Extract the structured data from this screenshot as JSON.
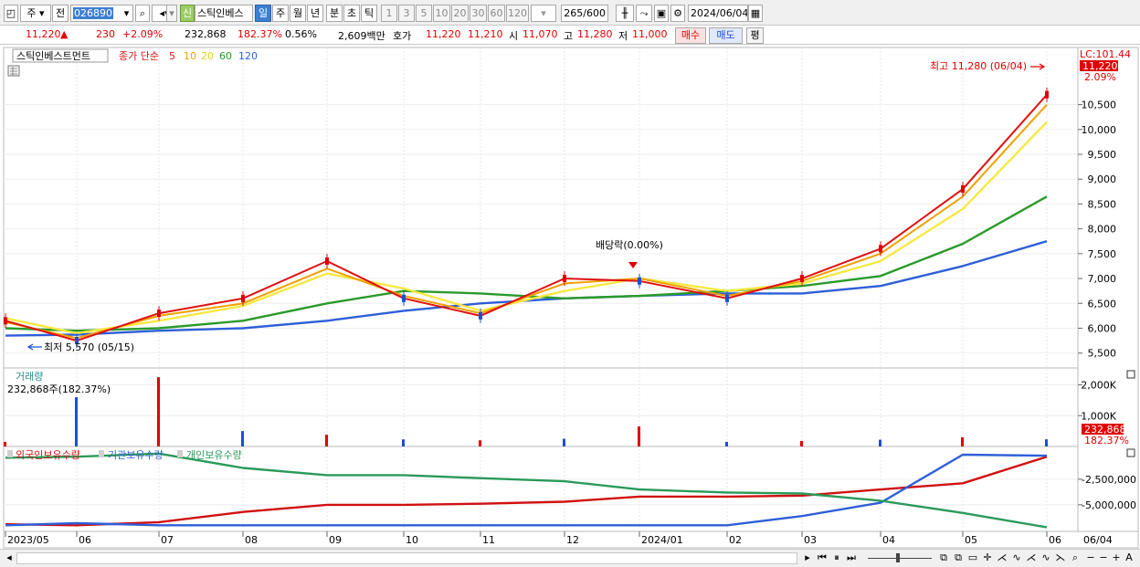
{
  "toolbar": {
    "market": "주",
    "prev": "전",
    "code": "026890",
    "shin": "신",
    "stock_name": "스틱인베스",
    "periods": [
      "일",
      "주",
      "월",
      "년",
      "분",
      "초",
      "틱"
    ],
    "active_period": "일",
    "minutes": [
      "1",
      "3",
      "5",
      "10",
      "20",
      "30",
      "60",
      "120"
    ],
    "count": "265",
    "count_max": "/600",
    "date": "2024/06/04"
  },
  "quote": {
    "price": "11,220",
    "arrow": "▲",
    "change": "230",
    "change_pct": "+2.09%",
    "volume": "232,868",
    "volume_ratio": "182.37%",
    "turnover": "0.56%",
    "amount": "2,609백만",
    "hoga_label": "호가",
    "ask": "11,220",
    "bid": "11,210",
    "open_label": "시",
    "open": "11,070",
    "high_label": "고",
    "high": "11,280",
    "low_label": "저",
    "low": "11,000",
    "buy": "매수",
    "sell": "매도",
    "avg": "평"
  },
  "price_panel": {
    "stock_tag": "스틱인베스트먼트",
    "legend_prefix": "종가 단순",
    "ma_periods": [
      "5",
      "10",
      "20",
      "60",
      "120"
    ],
    "lc_label": "LC:101.44",
    "price_badge": "11,220",
    "pct_badge": "2.09%",
    "high_annotation": "최고 11,280 (06/04)",
    "low_annotation": "최저 5,570 (05/15)",
    "dividend_annotation": "배당락(0.00%)"
  },
  "volume_panel": {
    "title": "거래량",
    "subtitle": "232,868주(182.37%)",
    "badge_value": "232,868",
    "badge_pct": "182.37%"
  },
  "holdings_panel": {
    "legend": [
      "외국인보유수량",
      "기관보유수량",
      "개인보유수량"
    ]
  },
  "x_axis": {
    "labels": [
      "2023/05",
      "06",
      "07",
      "08",
      "09",
      "10",
      "11",
      "12",
      "2024/01",
      "02",
      "03",
      "04",
      "05",
      "06"
    ],
    "right_label": "06/04"
  },
  "colors": {
    "ma5": "#e01010",
    "ma10": "#f0a000",
    "ma20": "#f8e840",
    "ma60": "#2a9a2a",
    "ma120": "#2e5fd8",
    "up": "#e00000",
    "down": "#1a4fd6",
    "foreign": "#d01010",
    "institution": "#2e5fd8",
    "individual": "#2a9a5a"
  },
  "chart_data": [
    {
      "type": "line",
      "name": "price",
      "x": [
        "2023/05",
        "06",
        "07",
        "08",
        "09",
        "10",
        "11",
        "12",
        "2024/01",
        "02",
        "03",
        "04",
        "05",
        "06"
      ],
      "y_ticks": [
        5500,
        6000,
        6500,
        7000,
        7500,
        8000,
        8500,
        9000,
        9500,
        10000,
        10500
      ],
      "ylim": [
        5200,
        11650
      ],
      "series": [
        {
          "name": "5",
          "values": [
            6150,
            5750,
            6300,
            6600,
            7350,
            6600,
            6250,
            7000,
            6950,
            6600,
            7000,
            7600,
            8800,
            10700
          ]
        },
        {
          "name": "10",
          "values": [
            6120,
            5800,
            6250,
            6500,
            7200,
            6650,
            6300,
            6900,
            7000,
            6650,
            6950,
            7500,
            8650,
            10500
          ]
        },
        {
          "name": "20",
          "values": [
            6200,
            5900,
            6150,
            6450,
            7100,
            6800,
            6350,
            6750,
            7000,
            6750,
            6900,
            7350,
            8400,
            10150
          ]
        },
        {
          "name": "60",
          "values": [
            6000,
            5950,
            6000,
            6150,
            6500,
            6750,
            6700,
            6600,
            6650,
            6750,
            6850,
            7050,
            7700,
            8650
          ]
        },
        {
          "name": "120",
          "values": [
            5850,
            5870,
            5950,
            6000,
            6150,
            6350,
            6500,
            6600,
            6650,
            6700,
            6700,
            6850,
            7250,
            7750
          ]
        }
      ],
      "annotations": [
        "최고 11,280 (06/04)",
        "최저 5,570 (05/15)",
        "배당락(0.00%)"
      ]
    },
    {
      "type": "bar",
      "name": "volume",
      "y_ticks": [
        1000000,
        2000000
      ],
      "ylim": [
        0,
        2550000
      ],
      "x": [
        "2023/05",
        "06",
        "07",
        "08",
        "09",
        "10",
        "11",
        "12",
        "2024/01",
        "02",
        "03",
        "04",
        "05",
        "06"
      ],
      "values": [
        150000,
        1600000,
        2250000,
        500000,
        380000,
        230000,
        200000,
        250000,
        650000,
        150000,
        180000,
        220000,
        300000,
        232868
      ]
    },
    {
      "type": "line",
      "name": "holdings",
      "y_ticks": [
        -2500000,
        -5000000
      ],
      "ylim": [
        -7600000,
        700000
      ],
      "x": [
        "2023/05",
        "06",
        "07",
        "08",
        "09",
        "10",
        "11",
        "12",
        "2024/01",
        "02",
        "03",
        "04",
        "05",
        "06"
      ],
      "series": [
        {
          "name": "외국인보유수량",
          "values": [
            -6900000,
            -7000000,
            -6700000,
            -5700000,
            -5000000,
            -5000000,
            -4900000,
            -4700000,
            -4200000,
            -4200000,
            -4100000,
            -3500000,
            -2900000,
            -300000
          ]
        },
        {
          "name": "기관보유수량",
          "values": [
            -7000000,
            -6800000,
            -7000000,
            -7000000,
            -7000000,
            -7000000,
            -7000000,
            -7000000,
            -7000000,
            -7000000,
            -6100000,
            -4800000,
            -100000,
            -200000
          ]
        },
        {
          "name": "개인보유수량",
          "values": [
            -400000,
            -300000,
            0,
            -1400000,
            -2100000,
            -2100000,
            -2400000,
            -2700000,
            -3500000,
            -3800000,
            -3900000,
            -4600000,
            -5800000,
            -7200000
          ]
        }
      ]
    }
  ]
}
